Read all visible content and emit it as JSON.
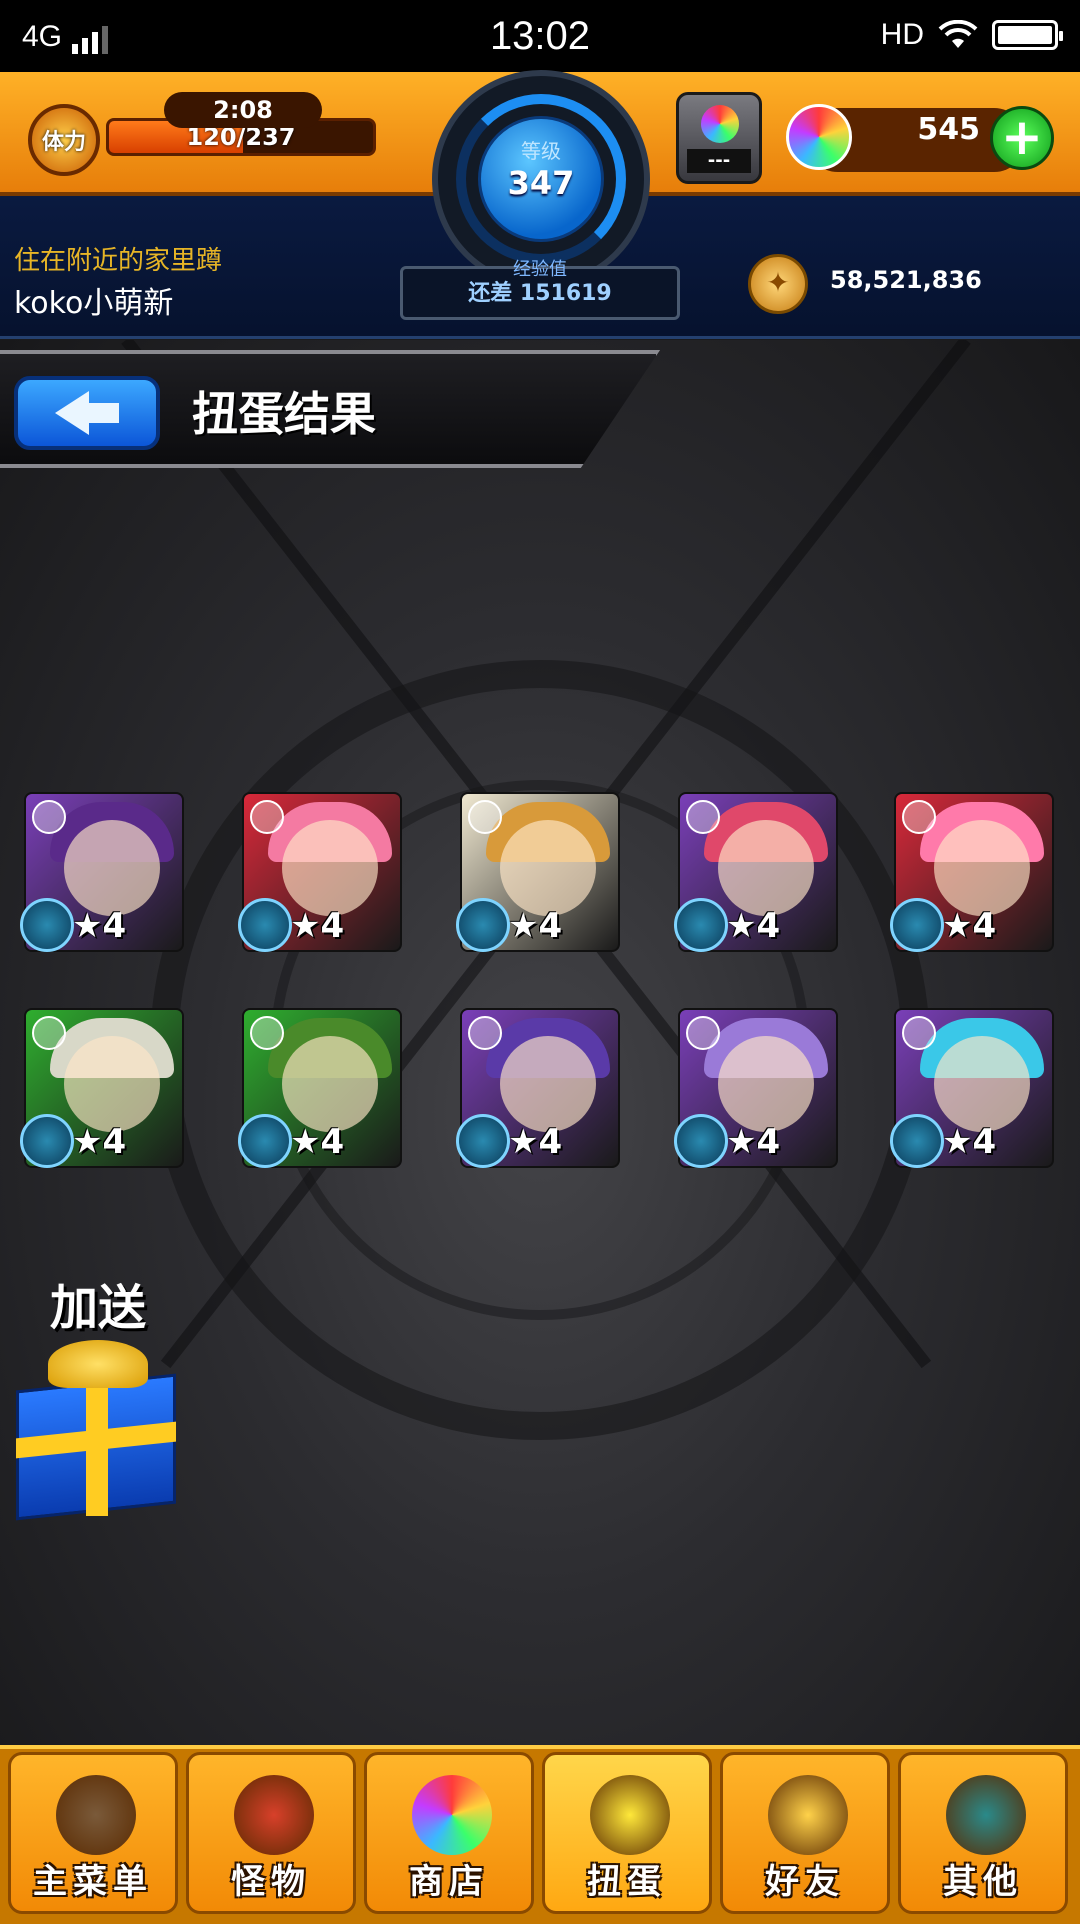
{
  "status_bar": {
    "network": "4G",
    "time": "13:02",
    "hd": "HD"
  },
  "header": {
    "stamina_label": "体力",
    "stamina_timer": "2:08",
    "stamina": "120/237",
    "stamina_fraction": 0.506,
    "level_label": "等级",
    "level": "347",
    "exp_label": "经验值",
    "exp_remaining": "还差 151619",
    "chest_value": "---",
    "orbs": "545",
    "coins": "58,521,836",
    "player_title": "住在附近的家里蹲",
    "player_name": "koko小萌新"
  },
  "page": {
    "title": "扭蛋结果"
  },
  "results": [
    {
      "rarity": "★4",
      "frame": "#7a3fb8",
      "hair": "#5a2a8a"
    },
    {
      "rarity": "★4",
      "frame": "#d8293a",
      "hair": "#f47aa2"
    },
    {
      "rarity": "★4",
      "frame": "#f0e8d0",
      "hair": "#d89a3a"
    },
    {
      "rarity": "★4",
      "frame": "#7a3fb8",
      "hair": "#e0486a"
    },
    {
      "rarity": "★4",
      "frame": "#d8293a",
      "hair": "#ff7aaa"
    },
    {
      "rarity": "★4",
      "frame": "#2fae2f",
      "hair": "#d8d8c8"
    },
    {
      "rarity": "★4",
      "frame": "#2fae2f",
      "hair": "#4a8a2a"
    },
    {
      "rarity": "★4",
      "frame": "#7a3fb8",
      "hair": "#5a3aa8"
    },
    {
      "rarity": "★4",
      "frame": "#7a3fb8",
      "hair": "#9a7ad8"
    },
    {
      "rarity": "★4",
      "frame": "#7a3fb8",
      "hair": "#3ac8e8"
    }
  ],
  "bonus_label": "加送",
  "nav": [
    {
      "label": "主菜单",
      "icon": "home-gate-icon",
      "color": "#7a5a3a"
    },
    {
      "label": "怪物",
      "icon": "monster-icon",
      "color": "#d8402a"
    },
    {
      "label": "商店",
      "icon": "rainbow-orb-icon",
      "color": "#5ab8ff"
    },
    {
      "label": "扭蛋",
      "icon": "gacha-egg-icon",
      "color": "#ffe83a"
    },
    {
      "label": "好友",
      "icon": "friends-icon",
      "color": "#ffd24a"
    },
    {
      "label": "其他",
      "icon": "question-icon",
      "color": "#2a8a8a"
    }
  ]
}
